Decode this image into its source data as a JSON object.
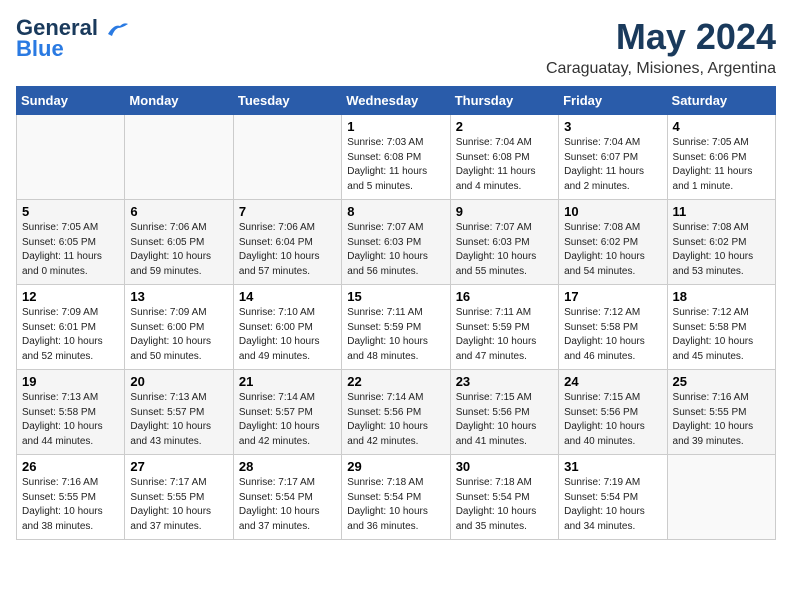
{
  "header": {
    "logo_line1": "General",
    "logo_line2": "Blue",
    "month_year": "May 2024",
    "location": "Caraguatay, Misiones, Argentina"
  },
  "days_of_week": [
    "Sunday",
    "Monday",
    "Tuesday",
    "Wednesday",
    "Thursday",
    "Friday",
    "Saturday"
  ],
  "weeks": [
    {
      "days": [
        {
          "num": "",
          "info": ""
        },
        {
          "num": "",
          "info": ""
        },
        {
          "num": "",
          "info": ""
        },
        {
          "num": "1",
          "info": "Sunrise: 7:03 AM\nSunset: 6:08 PM\nDaylight: 11 hours\nand 5 minutes."
        },
        {
          "num": "2",
          "info": "Sunrise: 7:04 AM\nSunset: 6:08 PM\nDaylight: 11 hours\nand 4 minutes."
        },
        {
          "num": "3",
          "info": "Sunrise: 7:04 AM\nSunset: 6:07 PM\nDaylight: 11 hours\nand 2 minutes."
        },
        {
          "num": "4",
          "info": "Sunrise: 7:05 AM\nSunset: 6:06 PM\nDaylight: 11 hours\nand 1 minute."
        }
      ]
    },
    {
      "days": [
        {
          "num": "5",
          "info": "Sunrise: 7:05 AM\nSunset: 6:05 PM\nDaylight: 11 hours\nand 0 minutes."
        },
        {
          "num": "6",
          "info": "Sunrise: 7:06 AM\nSunset: 6:05 PM\nDaylight: 10 hours\nand 59 minutes."
        },
        {
          "num": "7",
          "info": "Sunrise: 7:06 AM\nSunset: 6:04 PM\nDaylight: 10 hours\nand 57 minutes."
        },
        {
          "num": "8",
          "info": "Sunrise: 7:07 AM\nSunset: 6:03 PM\nDaylight: 10 hours\nand 56 minutes."
        },
        {
          "num": "9",
          "info": "Sunrise: 7:07 AM\nSunset: 6:03 PM\nDaylight: 10 hours\nand 55 minutes."
        },
        {
          "num": "10",
          "info": "Sunrise: 7:08 AM\nSunset: 6:02 PM\nDaylight: 10 hours\nand 54 minutes."
        },
        {
          "num": "11",
          "info": "Sunrise: 7:08 AM\nSunset: 6:02 PM\nDaylight: 10 hours\nand 53 minutes."
        }
      ]
    },
    {
      "days": [
        {
          "num": "12",
          "info": "Sunrise: 7:09 AM\nSunset: 6:01 PM\nDaylight: 10 hours\nand 52 minutes."
        },
        {
          "num": "13",
          "info": "Sunrise: 7:09 AM\nSunset: 6:00 PM\nDaylight: 10 hours\nand 50 minutes."
        },
        {
          "num": "14",
          "info": "Sunrise: 7:10 AM\nSunset: 6:00 PM\nDaylight: 10 hours\nand 49 minutes."
        },
        {
          "num": "15",
          "info": "Sunrise: 7:11 AM\nSunset: 5:59 PM\nDaylight: 10 hours\nand 48 minutes."
        },
        {
          "num": "16",
          "info": "Sunrise: 7:11 AM\nSunset: 5:59 PM\nDaylight: 10 hours\nand 47 minutes."
        },
        {
          "num": "17",
          "info": "Sunrise: 7:12 AM\nSunset: 5:58 PM\nDaylight: 10 hours\nand 46 minutes."
        },
        {
          "num": "18",
          "info": "Sunrise: 7:12 AM\nSunset: 5:58 PM\nDaylight: 10 hours\nand 45 minutes."
        }
      ]
    },
    {
      "days": [
        {
          "num": "19",
          "info": "Sunrise: 7:13 AM\nSunset: 5:58 PM\nDaylight: 10 hours\nand 44 minutes."
        },
        {
          "num": "20",
          "info": "Sunrise: 7:13 AM\nSunset: 5:57 PM\nDaylight: 10 hours\nand 43 minutes."
        },
        {
          "num": "21",
          "info": "Sunrise: 7:14 AM\nSunset: 5:57 PM\nDaylight: 10 hours\nand 42 minutes."
        },
        {
          "num": "22",
          "info": "Sunrise: 7:14 AM\nSunset: 5:56 PM\nDaylight: 10 hours\nand 42 minutes."
        },
        {
          "num": "23",
          "info": "Sunrise: 7:15 AM\nSunset: 5:56 PM\nDaylight: 10 hours\nand 41 minutes."
        },
        {
          "num": "24",
          "info": "Sunrise: 7:15 AM\nSunset: 5:56 PM\nDaylight: 10 hours\nand 40 minutes."
        },
        {
          "num": "25",
          "info": "Sunrise: 7:16 AM\nSunset: 5:55 PM\nDaylight: 10 hours\nand 39 minutes."
        }
      ]
    },
    {
      "days": [
        {
          "num": "26",
          "info": "Sunrise: 7:16 AM\nSunset: 5:55 PM\nDaylight: 10 hours\nand 38 minutes."
        },
        {
          "num": "27",
          "info": "Sunrise: 7:17 AM\nSunset: 5:55 PM\nDaylight: 10 hours\nand 37 minutes."
        },
        {
          "num": "28",
          "info": "Sunrise: 7:17 AM\nSunset: 5:54 PM\nDaylight: 10 hours\nand 37 minutes."
        },
        {
          "num": "29",
          "info": "Sunrise: 7:18 AM\nSunset: 5:54 PM\nDaylight: 10 hours\nand 36 minutes."
        },
        {
          "num": "30",
          "info": "Sunrise: 7:18 AM\nSunset: 5:54 PM\nDaylight: 10 hours\nand 35 minutes."
        },
        {
          "num": "31",
          "info": "Sunrise: 7:19 AM\nSunset: 5:54 PM\nDaylight: 10 hours\nand 34 minutes."
        },
        {
          "num": "",
          "info": ""
        }
      ]
    }
  ]
}
